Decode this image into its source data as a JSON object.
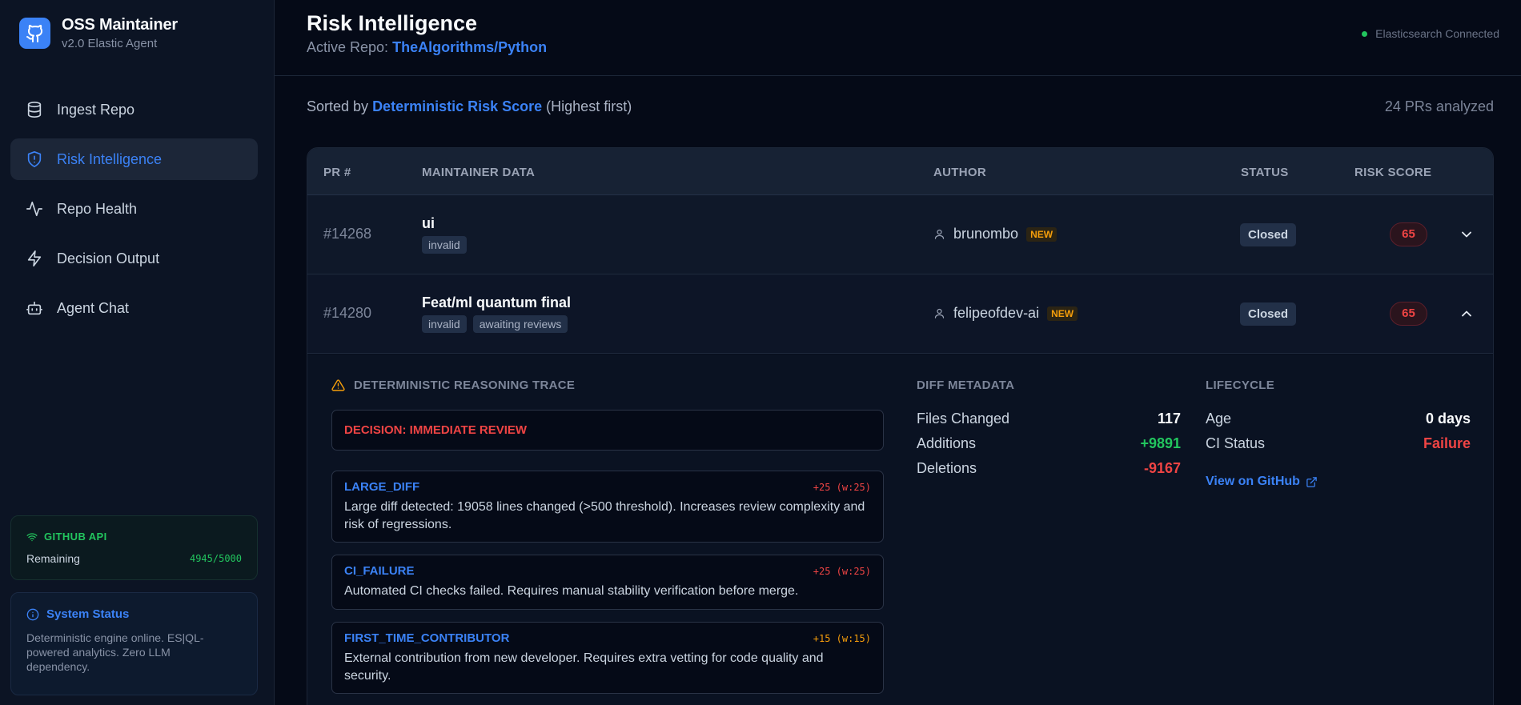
{
  "brand": {
    "title": "OSS Maintainer",
    "subtitle": "v2.0 Elastic Agent",
    "logo_icon": "github-icon",
    "accent": "#3b82f6"
  },
  "nav": {
    "items": [
      {
        "label": "Ingest Repo",
        "icon": "database-icon",
        "active": false
      },
      {
        "label": "Risk Intelligence",
        "icon": "shield-icon",
        "active": true
      },
      {
        "label": "Repo Health",
        "icon": "activity-icon",
        "active": false
      },
      {
        "label": "Decision Output",
        "icon": "lightning-icon",
        "active": false
      },
      {
        "label": "Agent Chat",
        "icon": "bot-icon",
        "active": false
      }
    ]
  },
  "github_api": {
    "title": "GITHUB API",
    "remaining_label": "Remaining",
    "remaining_value": "4945/5000"
  },
  "system_status": {
    "title": "System Status",
    "text": "Deterministic engine online. ES|QL-powered analytics. Zero LLM dependency."
  },
  "header": {
    "title": "Risk Intelligence",
    "active_repo_label": "Active Repo:",
    "active_repo": "TheAlgorithms/Python",
    "connection": "Elasticsearch Connected"
  },
  "sort": {
    "prefix": "Sorted by",
    "field": "Deterministic Risk Score",
    "suffix": "(Highest first)",
    "count": "24 PRs analyzed"
  },
  "table": {
    "columns": [
      "PR #",
      "MAINTAINER DATA",
      "AUTHOR",
      "STATUS",
      "RISK SCORE"
    ],
    "rows": [
      {
        "number": "#14268",
        "title": "ui",
        "tags": [
          "invalid"
        ],
        "author": "brunombo",
        "badge": "NEW",
        "status": "Closed",
        "score": "65",
        "expanded": false
      },
      {
        "number": "#14280",
        "title": "Feat/ml quantum final",
        "tags": [
          "invalid",
          "awaiting reviews"
        ],
        "author": "felipeofdev-ai",
        "badge": "NEW",
        "status": "Closed",
        "score": "65",
        "expanded": true
      }
    ]
  },
  "details": {
    "trace_title": "DETERMINISTIC REASONING TRACE",
    "decision": "DECISION: IMMEDIATE REVIEW",
    "traces": [
      {
        "code": "LARGE_DIFF",
        "weight": "+25 (w:25)",
        "weight_color": "#ef4444",
        "desc": "Large diff detected: 19058 lines changed (>500 threshold). Increases review complexity and risk of regressions."
      },
      {
        "code": "CI_FAILURE",
        "weight": "+25 (w:25)",
        "weight_color": "#ef4444",
        "desc": "Automated CI checks failed. Requires manual stability verification before merge."
      },
      {
        "code": "FIRST_TIME_CONTRIBUTOR",
        "weight": "+15 (w:15)",
        "weight_color": "#f59e0b",
        "desc": "External contribution from new developer. Requires extra vetting for code quality and security."
      }
    ],
    "diff": {
      "title": "DIFF METADATA",
      "files_label": "Files Changed",
      "files": "117",
      "additions_label": "Additions",
      "additions": "+9891",
      "deletions_label": "Deletions",
      "deletions": "-9167"
    },
    "lifecycle": {
      "title": "LIFECYCLE",
      "age_label": "Age",
      "age": "0 days",
      "ci_label": "CI Status",
      "ci": "Failure",
      "github_link": "View on GitHub"
    }
  }
}
